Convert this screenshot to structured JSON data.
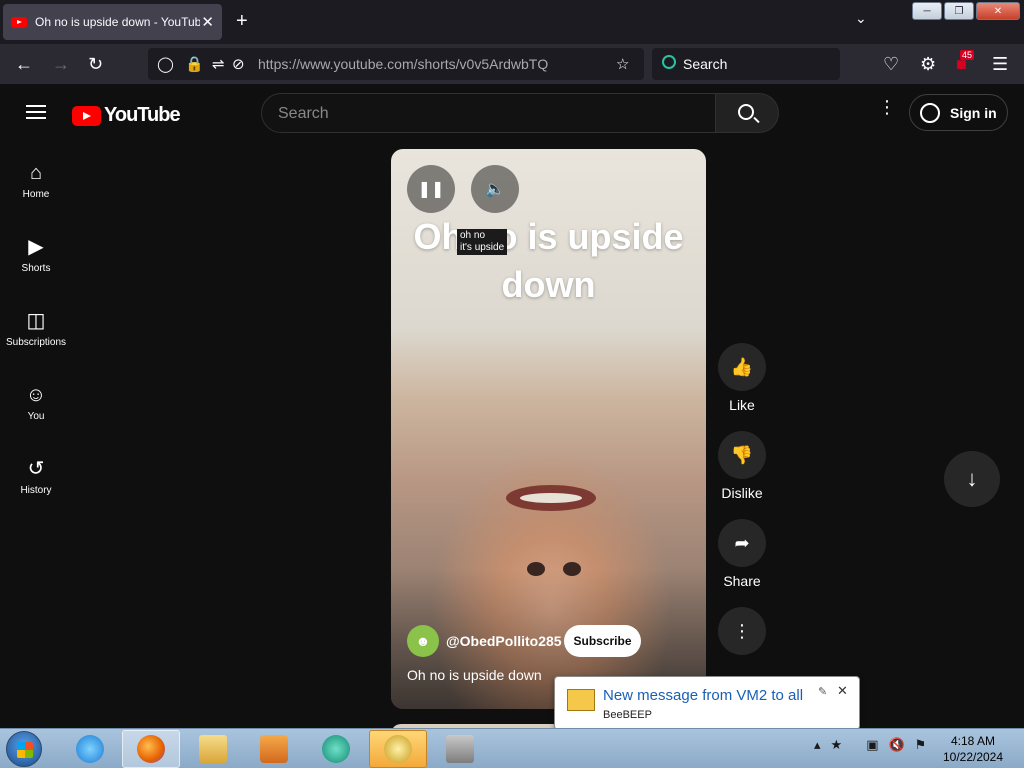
{
  "browser": {
    "tab_title": "Oh no is upside down - YouTube",
    "tab_close": "✕",
    "new_tab": "+",
    "url": "https://www.youtube.com/shorts/v0v5ArdwbTQ",
    "search_placeholder": "Search",
    "extension_badge": "45"
  },
  "youtube": {
    "logo_text": "YouTube",
    "search_placeholder": "Search",
    "sign_in": "Sign in",
    "sidebar": [
      {
        "label": "Home",
        "icon": "home-icon"
      },
      {
        "label": "Shorts",
        "icon": "shorts-icon"
      },
      {
        "label": "Subscriptions",
        "icon": "subscriptions-icon"
      },
      {
        "label": "You",
        "icon": "you-icon"
      },
      {
        "label": "History",
        "icon": "history-icon"
      }
    ]
  },
  "short": {
    "overlay_caption": "Oh no is upside down",
    "tooltip_line1": "oh no",
    "tooltip_line2": "it's upside",
    "channel": "@ObedPollito285",
    "subscribe": "Subscribe",
    "title": "Oh no is upside down",
    "actions": {
      "like": "Like",
      "dislike": "Dislike",
      "share": "Share"
    }
  },
  "notification": {
    "title": "New message from VM2 to all",
    "app": "BeeBEEP"
  },
  "taskbar": {
    "time": "4:18 AM",
    "date": "10/22/2024"
  }
}
